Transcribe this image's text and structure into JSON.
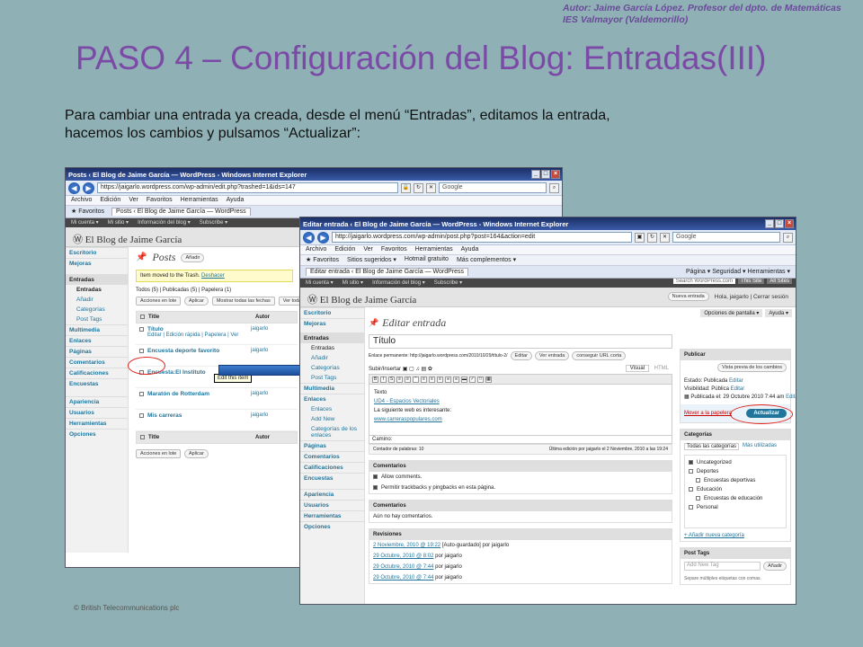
{
  "slide": {
    "author_line1": "Autor: Jaime García López. Profesor del dpto. de Matemáticas",
    "author_line2": "IES Valmayor (Valdemorillo)",
    "title": "PASO 4 – Configuración del Blog: Entradas(III)",
    "instruction_line1": "Para cambiar una entrada ya creada, desde el menú “Entradas”, editamos la entrada,",
    "instruction_line2": "hacemos los cambios y pulsamos “Actualizar”:",
    "copyright": "© British Telecommunications plc"
  },
  "win1": {
    "title": "Posts ‹ El Blog de Jaime García — WordPress - Windows Internet Explorer",
    "url": "https://jaigarlo.wordpress.com/wp-admin/edit.php?trashed=1&ids=147",
    "search": "Google",
    "menu": [
      "Archivo",
      "Edición",
      "Ver",
      "Favoritos",
      "Herramientas",
      "Ayuda"
    ],
    "fav_label": "Favoritos",
    "tab": "Posts ‹ El Blog de Jaime García — WordPress",
    "wpbar": [
      "Mi cuenta ▾",
      "Mi sitio ▾",
      "Información del blog ▾",
      "Subscribe ▾"
    ],
    "blog_name": "El Blog de Jaime García",
    "heading": "Posts",
    "add_new": "Añadir",
    "notice_text": "Item moved to the Trash.",
    "notice_undo": "Deshacer",
    "filter": "Todos (5) | Publicadas (5) | Papelera (1)",
    "bulk": "Acciones en lote",
    "apply": "Aplicar",
    "dates": "Mostrar todas las fechas",
    "view": "Ver todas las",
    "col_title": "Title",
    "col_author": "Autor",
    "nav": {
      "escritorio": "Escritorio",
      "mejoras": "Mejoras",
      "entradas": "Entradas",
      "entradas_sub": [
        "Entradas",
        "Añadir",
        "Categorías",
        "Post Tags"
      ],
      "multimedia": "Multimedia",
      "enlaces": "Enlaces",
      "paginas": "Páginas",
      "comentarios": "Comentarios",
      "calificaciones": "Calificaciones",
      "encuestas": "Encuestas",
      "apariencia": "Apariencia",
      "usuarios": "Usuarios",
      "herramientas": "Herramientas",
      "opciones": "Opciones"
    },
    "rows": [
      {
        "title": "Título",
        "actions": "Editar | Edición rápida | Papelera | Ver",
        "tooltip": "Edit this item",
        "author": "jaigarlo"
      },
      {
        "title": "Encuesta deporte favorito",
        "author": "jaigarlo"
      },
      {
        "title": "Encuesta:El Instituto",
        "author": "jaigarlo"
      },
      {
        "title": "Maratón de Rotterdam",
        "author": "jaigarlo"
      },
      {
        "title": "Mis carreras",
        "author": "jaigarlo"
      }
    ]
  },
  "win2": {
    "title": "Editar entrada ‹ El Blog de Jaime García — WordPress - Windows Internet Explorer",
    "url": "http://jaigarlo.wordpress.com/wp-admin/post.php?post=164&action=edit",
    "search": "Google",
    "menu": [
      "Archivo",
      "Edición",
      "Ver",
      "Favoritos",
      "Herramientas",
      "Ayuda"
    ],
    "favs": [
      "Favoritos",
      "Sitios sugeridos ▾",
      "Hotmail gratuito",
      "Más complementos ▾"
    ],
    "tab": "Editar entrada ‹ El Blog de Jaime García — WordPress",
    "ie_tools": "Página ▾  Seguridad ▾  Herramientas ▾",
    "wpbar": [
      "Mi cuenta ▾",
      "Mi sitio ▾",
      "Información del blog ▾",
      "Subscribe ▾"
    ],
    "search_wp": "Search WordPress.com",
    "this_site": "This Site",
    "all_sites": "All Sites",
    "blog_name": "El Blog de Jaime García",
    "new_entry": "Nueva entrada",
    "greeting": "Hola, jaigarlo | Cerrar sesión",
    "screen_opts": "Opciones de pantalla ▾",
    "help": "Ayuda ▾",
    "heading": "Editar entrada",
    "post_title": "Título",
    "permalink": "Enlace permanente: http://jaigarlo.wordpress.com/2010/10/29/título-2/",
    "btn_edit": "Editar",
    "btn_view": "Ver entrada",
    "btn_short": "conseguir URL corta",
    "upload": "Subir/Insertar",
    "tab_visual": "Visual",
    "tab_html": "HTML",
    "content": {
      "line1": "Texto",
      "link1": "UD4 - Espacios Vectoriales",
      "line3": "La siguiente web es interesante:",
      "link2": "www.carreraspopulares.com"
    },
    "path": "Camino:",
    "word_count": "Contador de palabras: 10",
    "last_edit": "Última edición por jaigarlo el 2 Noviembre, 2010 a las 19:24",
    "comments_box": "Comentarios",
    "allow_comments": "Allow comments.",
    "allow_trackbacks": "Permitir trackbacks y pingbacks en esta página.",
    "comments2": "Comentarios",
    "no_comments": "Aún no hay comentarios.",
    "revisions": "Revisiones",
    "rev_items": [
      {
        "date": "2 Noviembre, 2010 @ 19:22",
        "by": "[Auto-guardado] por jaigarlo"
      },
      {
        "date": "29 Octubre, 2010 @ 8:02",
        "by": "por jaigarlo"
      },
      {
        "date": "29 Octubre, 2010 @ 7:44",
        "by": "por jaigarlo"
      },
      {
        "date": "29 Octubre, 2010 @ 7:44",
        "by": "por jaigarlo"
      }
    ],
    "publish": "Publicar",
    "preview": "Vista previa de los cambios",
    "status": "Estado: Publicada",
    "visibility": "Visibilidad: Pública",
    "published_on": "Publicada el: 29 Octubre 2010 7:44 am",
    "edit_link": "Editar",
    "trash": "Mover a la papelera",
    "update": "Actualizar",
    "categories": "Categorías",
    "cat_all": "Todas las categorías",
    "cat_used": "Más utilizadas",
    "cats": [
      "Uncategorized",
      "Deportes",
      "Encuestas deportivas",
      "Educación",
      "Encuestas de educación",
      "Personal"
    ],
    "add_cat": "+ Añadir nueva categoría",
    "post_tags": "Post Tags",
    "add_tag_ph": "Add New Tag",
    "add_tag_btn": "Añadir",
    "tags_hint": "Separe múltiples etiquetas con comas.",
    "nav": {
      "escritorio": "Escritorio",
      "mejoras": "Mejoras",
      "entradas": "Entradas",
      "entradas_sub": [
        "Entradas",
        "Añadir",
        "Categorías",
        "Post Tags"
      ],
      "multimedia": "Multimedia",
      "enlaces": "Enlaces",
      "enlaces_sub": [
        "Enlaces",
        "Add New",
        "Categorías de los enlaces"
      ],
      "paginas": "Páginas",
      "comentarios": "Comentarios",
      "calificaciones": "Calificaciones",
      "encuestas": "Encuestas",
      "apariencia": "Apariencia",
      "usuarios": "Usuarios",
      "herramientas": "Herramientas",
      "opciones": "Opciones"
    }
  },
  "colors": {
    "slide_bg": "#8fb0b4",
    "title": "#7b4aa6",
    "wp_link": "#21759b",
    "highlight": "#e0201a",
    "arrow": "#1d4f9a"
  }
}
